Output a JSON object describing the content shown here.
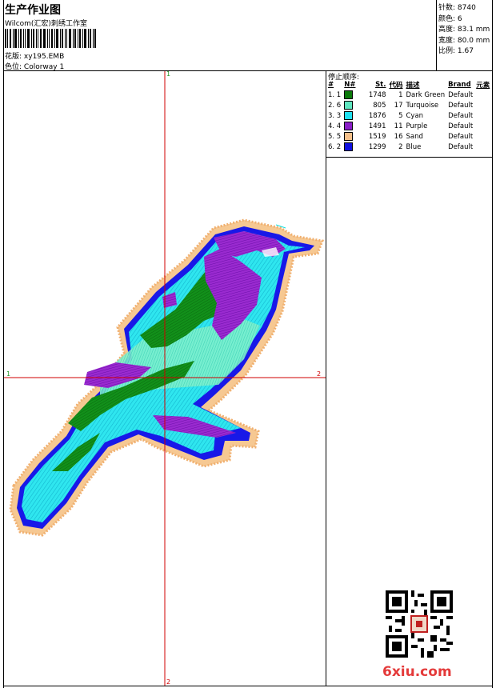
{
  "header": {
    "title": "生产作业图",
    "company": "Wilcom(汇宏)刺绣工作室",
    "design_label": "花版:",
    "design_value": "xy195.EMB",
    "colorway_label": "色位:",
    "colorway_value": "Colorway 1"
  },
  "stats": {
    "stitches": "针数: 8740",
    "colors": "颜色: 6",
    "height": "高度: 83.1 mm",
    "width": "宽度: 80.0 mm",
    "ratio": "比例: 1.67"
  },
  "stop_sequence": {
    "label": "停止顺序:",
    "headers": [
      "#",
      "N#",
      "St.",
      "代码",
      "描述",
      "Brand",
      "元素"
    ],
    "rows": [
      {
        "idx": "1. 1",
        "color": "#0a7a0a",
        "st": "1748",
        "code": "1",
        "desc": "Dark Green",
        "brand": "Default"
      },
      {
        "idx": "2. 6",
        "color": "#5fe6c0",
        "st": "805",
        "code": "17",
        "desc": "Turquoise",
        "brand": "Default"
      },
      {
        "idx": "3. 3",
        "color": "#20e0f0",
        "st": "1876",
        "code": "5",
        "desc": "Cyan",
        "brand": "Default"
      },
      {
        "idx": "4. 4",
        "color": "#8a1fc8",
        "st": "1491",
        "code": "11",
        "desc": "Purple",
        "brand": "Default"
      },
      {
        "idx": "5. 5",
        "color": "#f5c08a",
        "st": "1519",
        "code": "16",
        "desc": "Sand",
        "brand": "Default"
      },
      {
        "idx": "6. 2",
        "color": "#1010e0",
        "st": "1299",
        "code": "2",
        "desc": "Blue",
        "brand": "Default"
      }
    ]
  },
  "axes": {
    "top": "1",
    "bottom": "2",
    "left": "1",
    "right": "2"
  },
  "watermark": {
    "site": "6xiu.com",
    "qr_icon": "qr-code-icon"
  }
}
